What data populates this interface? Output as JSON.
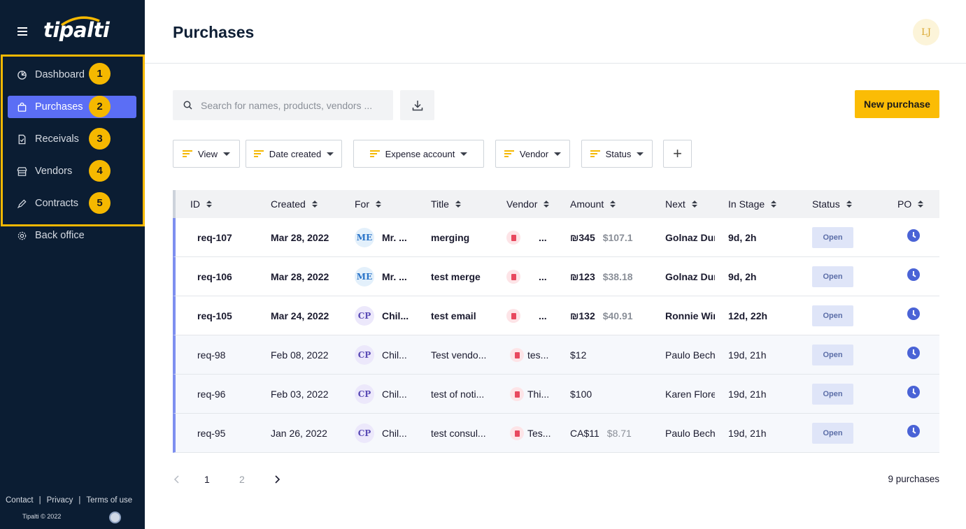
{
  "app": {
    "logo": "tipalti"
  },
  "sidebar": {
    "items": [
      {
        "label": "Dashboard",
        "badge": "1",
        "icon": "pie-chart-icon",
        "active": false
      },
      {
        "label": "Purchases",
        "badge": "2",
        "icon": "shopping-bag-icon",
        "active": true
      },
      {
        "label": "Receivals",
        "badge": "3",
        "icon": "document-check-icon",
        "active": false
      },
      {
        "label": "Vendors",
        "badge": "4",
        "icon": "store-icon",
        "active": false
      },
      {
        "label": "Contracts",
        "badge": "5",
        "icon": "pen-icon",
        "active": false
      }
    ],
    "back_office": "Back office",
    "footer": {
      "contact": "Contact",
      "privacy": "Privacy",
      "terms": "Terms of use",
      "copyright": "Tipalti © 2022"
    }
  },
  "header": {
    "title": "Purchases",
    "avatar_initials": "LJ"
  },
  "toolbar": {
    "search_placeholder": "Search for names, products, vendors ...",
    "new_purchase": "New purchase"
  },
  "filters": {
    "view": "View",
    "date_created": "Date created",
    "expense_account": "Expense account",
    "vendor": "Vendor",
    "status": "Status",
    "add": "+"
  },
  "table": {
    "columns": [
      "ID",
      "Created",
      "For",
      "Title",
      "Vendor",
      "Amount",
      "Next",
      "In Stage",
      "Status",
      "PO"
    ],
    "rows": [
      {
        "id": "req-107",
        "created": "Mar 28, 2022",
        "for_initials": "ME",
        "for_name": "Mr. ...",
        "title": "merging",
        "vendor": "...",
        "amount": "₪345",
        "amount_usd": "$107.1",
        "next": "Golnaz Dur",
        "stage": "9d, 2h",
        "status": "Open",
        "unread": true
      },
      {
        "id": "req-106",
        "created": "Mar 28, 2022",
        "for_initials": "ME",
        "for_name": "Mr. ...",
        "title": "test merge",
        "vendor": "...",
        "amount": "₪123",
        "amount_usd": "$38.18",
        "next": "Golnaz Dur",
        "stage": "9d, 2h",
        "status": "Open",
        "unread": true
      },
      {
        "id": "req-105",
        "created": "Mar 24, 2022",
        "for_initials": "CP",
        "for_name": "Chil...",
        "title": "test email",
        "vendor": "...",
        "amount": "₪132",
        "amount_usd": "$40.91",
        "next": "Ronnie Wir",
        "stage": "12d, 22h",
        "status": "Open",
        "unread": true
      },
      {
        "id": "req-98",
        "created": "Feb 08, 2022",
        "for_initials": "CP",
        "for_name": "Chil...",
        "title": "Test vendo...",
        "vendor": "tes...",
        "amount": "$12",
        "amount_usd": "",
        "next": "Paulo Becha",
        "stage": "19d, 21h",
        "status": "Open",
        "unread": false
      },
      {
        "id": "req-96",
        "created": "Feb 03, 2022",
        "for_initials": "CP",
        "for_name": "Chil...",
        "title": "test of noti...",
        "vendor": "Thi...",
        "amount": "$100",
        "amount_usd": "",
        "next": "Karen Flore",
        "stage": "19d, 21h",
        "status": "Open",
        "unread": false
      },
      {
        "id": "req-95",
        "created": "Jan 26, 2022",
        "for_initials": "CP",
        "for_name": "Chil...",
        "title": "test consul...",
        "vendor": "Tes...",
        "amount": "CA$11",
        "amount_usd": "$8.71",
        "next": "Paulo Becha",
        "stage": "19d, 21h",
        "status": "Open",
        "unread": false
      }
    ]
  },
  "pagination": {
    "pages": [
      "1",
      "2"
    ],
    "current": "1",
    "count": "9 purchases"
  }
}
